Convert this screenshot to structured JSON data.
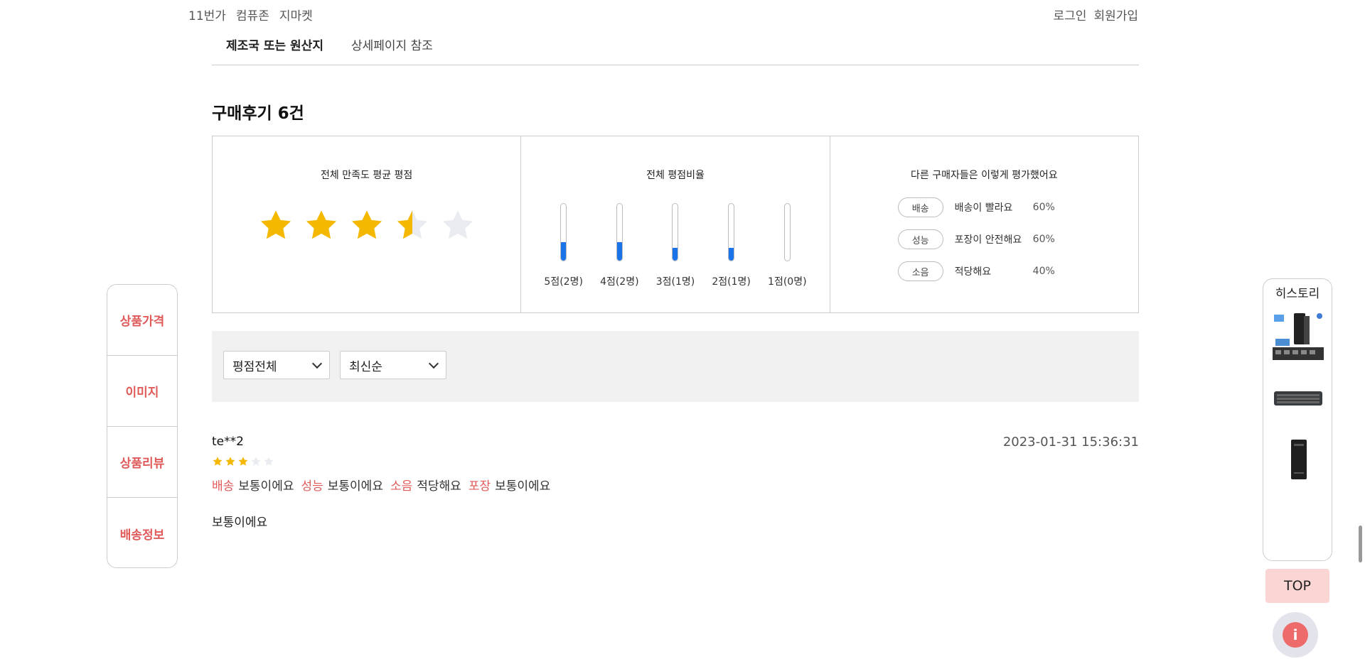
{
  "topnav": {
    "links": [
      "11번가",
      "컴퓨존",
      "지마켓"
    ]
  },
  "auth": {
    "login": "로그인",
    "signup": "회원가입"
  },
  "origin": {
    "label": "제조국 또는 원산지",
    "value": "상세페이지 참조"
  },
  "reviews": {
    "title": "구매후기 6건",
    "avg_title": "전체 만족도 평균 평점",
    "avg_rating": 3.5,
    "ratio_title": "전체 평점비율",
    "ratio": [
      {
        "label": "5점(2명)",
        "fill": 0.33
      },
      {
        "label": "4점(2명)",
        "fill": 0.33
      },
      {
        "label": "3점(1명)",
        "fill": 0.22
      },
      {
        "label": "2점(1명)",
        "fill": 0.22
      },
      {
        "label": "1점(0명)",
        "fill": 0
      }
    ],
    "eval_title": "다른 구매자들은 이렇게 평가했어요",
    "eval": [
      {
        "tag": "배송",
        "text": "배송이 빨라요",
        "pct": "60%"
      },
      {
        "tag": "성능",
        "text": "포장이 안전해요",
        "pct": "60%"
      },
      {
        "tag": "소음",
        "text": "적당해요",
        "pct": "40%"
      }
    ]
  },
  "filters": {
    "rating": "평점전체",
    "sort": "최신순"
  },
  "review_item": {
    "user": "te**2",
    "date": "2023-01-31 15:36:31",
    "rating": 3,
    "attrs": [
      {
        "k": "배송",
        "v": "보통이에요"
      },
      {
        "k": "성능",
        "v": "보통이에요"
      },
      {
        "k": "소음",
        "v": "적당해요"
      },
      {
        "k": "포장",
        "v": "보통이에요"
      }
    ],
    "body": "보통이에요"
  },
  "leftnav": {
    "items": [
      "상품가격",
      "이미지",
      "상품리뷰",
      "배송정보"
    ]
  },
  "history": {
    "title": "히스토리"
  },
  "top_button": "TOP",
  "colors": {
    "accent_red": "#e05a5a",
    "star": "#f5b800",
    "star_empty": "#e8ebef",
    "bar_blue": "#1a73e8",
    "top_bg": "#fbd4d4"
  }
}
